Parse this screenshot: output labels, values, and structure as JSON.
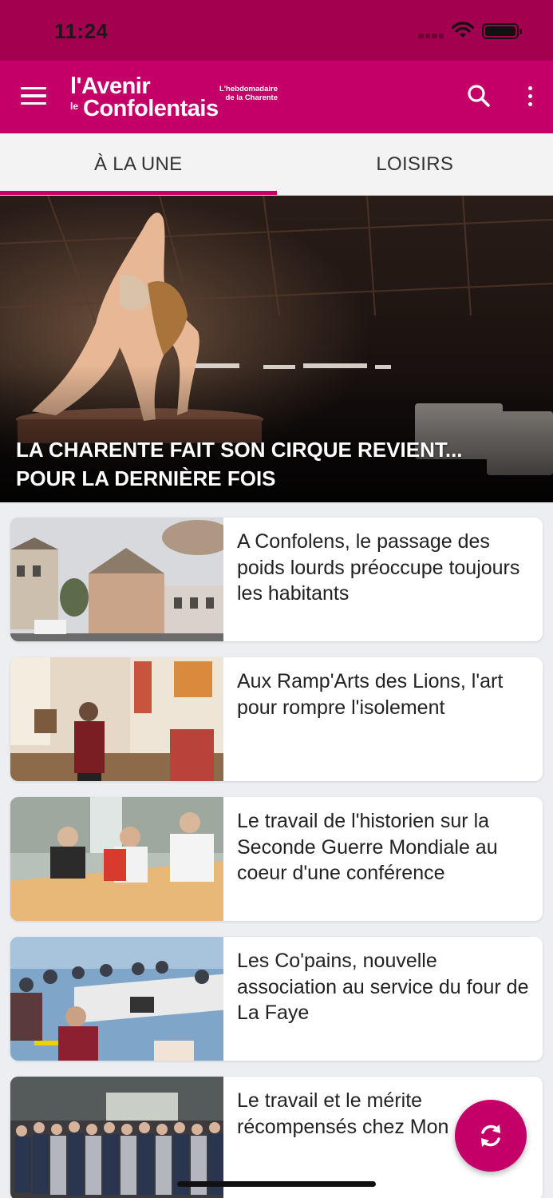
{
  "status_bar": {
    "time": "11:24",
    "icons": [
      "signal-icon",
      "wifi-icon",
      "battery-icon"
    ]
  },
  "app_bar": {
    "logo": {
      "line1": "l'Avenir",
      "le": "le",
      "line2": "Confolentais",
      "tagline_1": "L'hebdomadaire",
      "tagline_2": "de la Charente"
    },
    "icons": [
      "menu-icon",
      "search-icon",
      "more-vert-icon"
    ]
  },
  "tabs": [
    {
      "label": "À LA UNE",
      "active": true
    },
    {
      "label": "LOISIRS",
      "active": false
    }
  ],
  "hero": {
    "title": "LA CHARENTE FAIT SON CIRQUE REVIENT... POUR LA DERNIÈRE FOIS"
  },
  "articles": [
    {
      "title": "A Confolens, le passage des poids lourds préoccupe toujours les habitants"
    },
    {
      "title": "Aux Ramp'Arts des Lions, l'art pour rompre l'isolement"
    },
    {
      "title": "Le travail de l'historien sur la Seconde Guerre Mondiale au coeur d'une conférence"
    },
    {
      "title": "Les Co'pains, nouvelle association au service du four de La Faye"
    },
    {
      "title": "Le travail et le mérite récompensés chez Mon"
    }
  ],
  "fab": {
    "icon": "refresh-icon"
  },
  "colors": {
    "brand": "#c40068",
    "status_bar": "#a3004f",
    "background": "#eceef1"
  }
}
